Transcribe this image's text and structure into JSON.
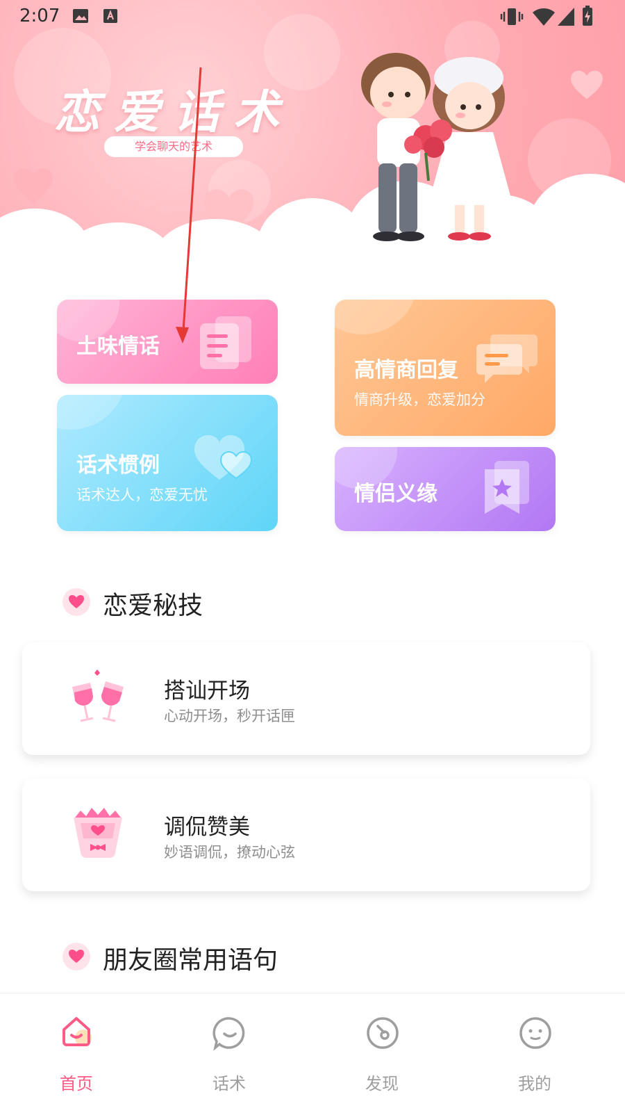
{
  "status_bar": {
    "time": "2:07"
  },
  "hero": {
    "title": "恋爱话术",
    "subtitle": "学会聊天的艺术"
  },
  "features": [
    {
      "title": "土味情话",
      "subtitle": ""
    },
    {
      "title": "高情商回复",
      "subtitle": "情商升级，恋爱加分"
    },
    {
      "title": "话术惯例",
      "subtitle": "话术达人，恋爱无忧"
    },
    {
      "title": "情侣义缘",
      "subtitle": ""
    }
  ],
  "section_tips": {
    "title": "恋爱秘技"
  },
  "tips": [
    {
      "title": "搭讪开场",
      "subtitle": "心动开场，秒开话匣"
    },
    {
      "title": "调侃赞美",
      "subtitle": "妙语调侃，撩动心弦"
    }
  ],
  "section_moments": {
    "title": "朋友圈常用语句"
  },
  "nav": [
    {
      "label": "首页",
      "icon": "home-icon",
      "active": true
    },
    {
      "label": "话术",
      "icon": "chat-icon",
      "active": false
    },
    {
      "label": "发现",
      "icon": "discover-icon",
      "active": false
    },
    {
      "label": "我的",
      "icon": "profile-icon",
      "active": false
    }
  ],
  "colors": {
    "accent": "#ff5b86",
    "card_pink": "#ff8ec0",
    "card_orange": "#ffb06a",
    "card_blue": "#6fd8f6",
    "card_purple": "#b77cf3"
  }
}
